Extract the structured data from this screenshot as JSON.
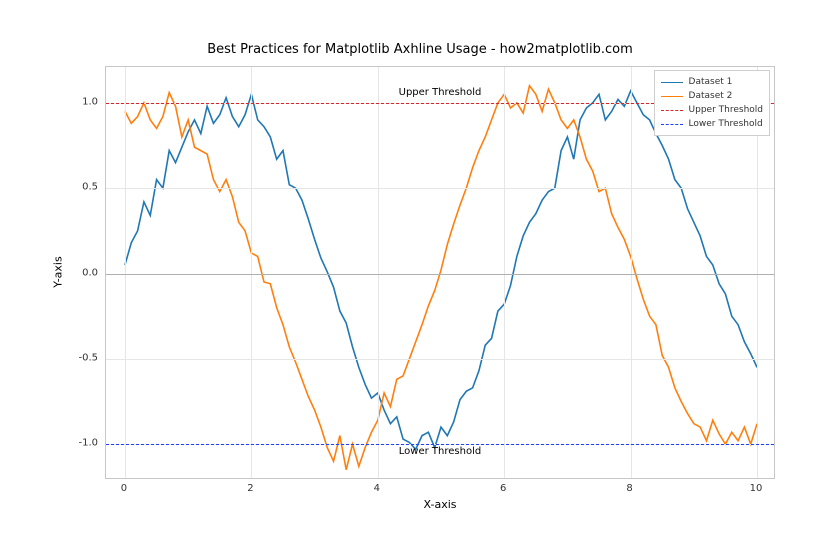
{
  "chart_data": {
    "type": "line",
    "title": "Best Practices for Matplotlib Axhline Usage - how2matplotlib.com",
    "xlabel": "X-axis",
    "ylabel": "Y-axis",
    "xlim": [
      -0.3,
      10.3
    ],
    "ylim": [
      -1.21,
      1.21
    ],
    "xticks": [
      0,
      2,
      4,
      6,
      8,
      10
    ],
    "yticks": [
      -1.0,
      -0.5,
      0.0,
      0.5,
      1.0
    ],
    "grid": true,
    "legend_position": "top-right",
    "annotations": [
      {
        "text": "Upper Threshold",
        "x": 5,
        "y": 1.05
      },
      {
        "text": "Lower Threshold",
        "x": 5,
        "y": -1.05
      }
    ],
    "hlines": [
      {
        "y": 1.0,
        "style": "dashed",
        "color": "#d62728",
        "label": "Upper Threshold"
      },
      {
        "y": 0.0,
        "style": "solid",
        "color": "#b0b0b0",
        "label": null
      },
      {
        "y": -1.0,
        "style": "dashed",
        "color": "#1f3fff",
        "label": "Lower Threshold"
      }
    ],
    "series": [
      {
        "name": "Dataset 1",
        "color": "#1f77b4",
        "x": [
          0,
          0.1,
          0.2,
          0.3,
          0.4,
          0.5,
          0.6,
          0.7,
          0.8,
          0.9,
          1.0,
          1.1,
          1.2,
          1.3,
          1.4,
          1.5,
          1.6,
          1.7,
          1.8,
          1.9,
          2.0,
          2.1,
          2.2,
          2.3,
          2.4,
          2.5,
          2.6,
          2.7,
          2.8,
          2.9,
          3.0,
          3.1,
          3.2,
          3.3,
          3.4,
          3.5,
          3.6,
          3.7,
          3.8,
          3.9,
          4.0,
          4.1,
          4.2,
          4.3,
          4.4,
          4.5,
          4.6,
          4.7,
          4.8,
          4.9,
          5.0,
          5.1,
          5.2,
          5.3,
          5.4,
          5.5,
          5.6,
          5.7,
          5.8,
          5.9,
          6.0,
          6.1,
          6.2,
          6.3,
          6.4,
          6.5,
          6.6,
          6.7,
          6.8,
          6.9,
          7.0,
          7.1,
          7.2,
          7.3,
          7.4,
          7.5,
          7.6,
          7.7,
          7.8,
          7.9,
          8.0,
          8.1,
          8.2,
          8.3,
          8.4,
          8.5,
          8.6,
          8.7,
          8.8,
          8.9,
          9.0,
          9.1,
          9.2,
          9.3,
          9.4,
          9.5,
          9.6,
          9.7,
          9.8,
          9.9,
          10.0
        ],
        "values": [
          0.05,
          0.18,
          0.25,
          0.42,
          0.34,
          0.55,
          0.5,
          0.72,
          0.65,
          0.74,
          0.83,
          0.9,
          0.82,
          0.98,
          0.88,
          0.93,
          1.03,
          0.92,
          0.86,
          0.93,
          1.05,
          0.9,
          0.86,
          0.8,
          0.67,
          0.72,
          0.52,
          0.5,
          0.43,
          0.32,
          0.2,
          0.09,
          0.01,
          -0.08,
          -0.22,
          -0.29,
          -0.43,
          -0.55,
          -0.65,
          -0.73,
          -0.7,
          -0.8,
          -0.88,
          -0.84,
          -0.97,
          -0.99,
          -1.03,
          -0.95,
          -0.93,
          -1.02,
          -0.9,
          -0.95,
          -0.87,
          -0.74,
          -0.69,
          -0.67,
          -0.57,
          -0.42,
          -0.38,
          -0.22,
          -0.18,
          -0.07,
          0.1,
          0.22,
          0.3,
          0.35,
          0.43,
          0.48,
          0.5,
          0.72,
          0.8,
          0.67,
          0.9,
          0.97,
          1.0,
          1.05,
          0.9,
          0.95,
          1.02,
          0.98,
          1.07,
          1.0,
          0.93,
          0.9,
          0.82,
          0.75,
          0.67,
          0.55,
          0.5,
          0.38,
          0.3,
          0.22,
          0.1,
          0.05,
          -0.06,
          -0.12,
          -0.25,
          -0.3,
          -0.4,
          -0.47,
          -0.55
        ]
      },
      {
        "name": "Dataset 2",
        "color": "#ff7f0e",
        "x": [
          0,
          0.1,
          0.2,
          0.3,
          0.4,
          0.5,
          0.6,
          0.7,
          0.8,
          0.9,
          1.0,
          1.1,
          1.2,
          1.3,
          1.4,
          1.5,
          1.6,
          1.7,
          1.8,
          1.9,
          2.0,
          2.1,
          2.2,
          2.3,
          2.4,
          2.5,
          2.6,
          2.7,
          2.8,
          2.9,
          3.0,
          3.1,
          3.2,
          3.3,
          3.4,
          3.5,
          3.6,
          3.7,
          3.8,
          3.9,
          4.0,
          4.1,
          4.2,
          4.3,
          4.4,
          4.5,
          4.6,
          4.7,
          4.8,
          4.9,
          5.0,
          5.1,
          5.2,
          5.3,
          5.4,
          5.5,
          5.6,
          5.7,
          5.8,
          5.9,
          6.0,
          6.1,
          6.2,
          6.3,
          6.4,
          6.5,
          6.6,
          6.7,
          6.8,
          6.9,
          7.0,
          7.1,
          7.2,
          7.3,
          7.4,
          7.5,
          7.6,
          7.7,
          7.8,
          7.9,
          8.0,
          8.1,
          8.2,
          8.3,
          8.4,
          8.5,
          8.6,
          8.7,
          8.8,
          8.9,
          9.0,
          9.1,
          9.2,
          9.3,
          9.4,
          9.5,
          9.6,
          9.7,
          9.8,
          9.9,
          10.0
        ],
        "values": [
          0.95,
          0.88,
          0.92,
          1.0,
          0.9,
          0.85,
          0.92,
          1.06,
          0.98,
          0.8,
          0.9,
          0.74,
          0.72,
          0.7,
          0.55,
          0.48,
          0.55,
          0.45,
          0.3,
          0.25,
          0.12,
          0.1,
          -0.05,
          -0.06,
          -0.2,
          -0.3,
          -0.43,
          -0.52,
          -0.62,
          -0.72,
          -0.8,
          -0.9,
          -1.02,
          -1.1,
          -0.95,
          -1.15,
          -1.0,
          -1.13,
          -1.02,
          -0.93,
          -0.86,
          -0.7,
          -0.78,
          -0.62,
          -0.6,
          -0.5,
          -0.4,
          -0.3,
          -0.19,
          -0.1,
          0.02,
          0.17,
          0.29,
          0.4,
          0.5,
          0.62,
          0.72,
          0.8,
          0.9,
          1.0,
          1.05,
          0.97,
          1.0,
          0.94,
          1.1,
          1.05,
          0.95,
          1.08,
          1.0,
          0.9,
          0.85,
          0.9,
          0.8,
          0.67,
          0.6,
          0.48,
          0.5,
          0.35,
          0.27,
          0.2,
          0.1,
          -0.03,
          -0.15,
          -0.25,
          -0.3,
          -0.48,
          -0.55,
          -0.67,
          -0.75,
          -0.82,
          -0.88,
          -0.9,
          -0.98,
          -0.86,
          -0.94,
          -1.0,
          -0.93,
          -0.98,
          -0.9,
          -1.0,
          -0.88
        ]
      }
    ],
    "legend": [
      "Dataset 1",
      "Dataset 2",
      "Upper Threshold",
      "Lower Threshold"
    ]
  }
}
